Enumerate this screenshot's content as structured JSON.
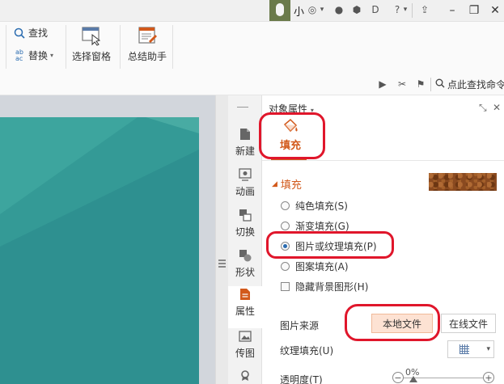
{
  "titlebar": {
    "username": "小",
    "window_buttons": [
      "minimize-icon",
      "restore-icon",
      "close-icon"
    ]
  },
  "ribbon": {
    "find_label": "查找",
    "replace_label": "替换",
    "select_pane_label": "选择窗格",
    "summary_assistant_label": "总结助手"
  },
  "subbar": {
    "search_text": "点此查找命令"
  },
  "sidetabs": [
    {
      "label": "新建",
      "icon": "new-icon"
    },
    {
      "label": "动画",
      "icon": "animation-icon"
    },
    {
      "label": "切换",
      "icon": "transition-icon"
    },
    {
      "label": "形状",
      "icon": "shape-icon"
    },
    {
      "label": "属性",
      "icon": "property-icon"
    },
    {
      "label": "传图",
      "icon": "upload-image-icon"
    }
  ],
  "panel": {
    "title": "对象属性",
    "fill_tab": "填充",
    "section": "填充",
    "options": [
      {
        "label": "纯色填充(S)",
        "checked": false
      },
      {
        "label": "渐变填充(G)",
        "checked": false
      },
      {
        "label": "图片或纹理填充(P)",
        "checked": true
      },
      {
        "label": "图案填充(A)",
        "checked": false
      }
    ],
    "hide_bg_label": "隐藏背景图形(H)",
    "picture_source_label": "图片来源",
    "local_file_button": "本地文件",
    "online_file_button": "在线文件",
    "texture_fill_label": "纹理填充(U)",
    "transparency_label": "透明度(T)",
    "transparency_value": "0%",
    "transparency_percent": 0
  },
  "colors": {
    "accent": "#d2591b",
    "slide_bg": "#2e9090",
    "annotation": "#e0162b"
  }
}
